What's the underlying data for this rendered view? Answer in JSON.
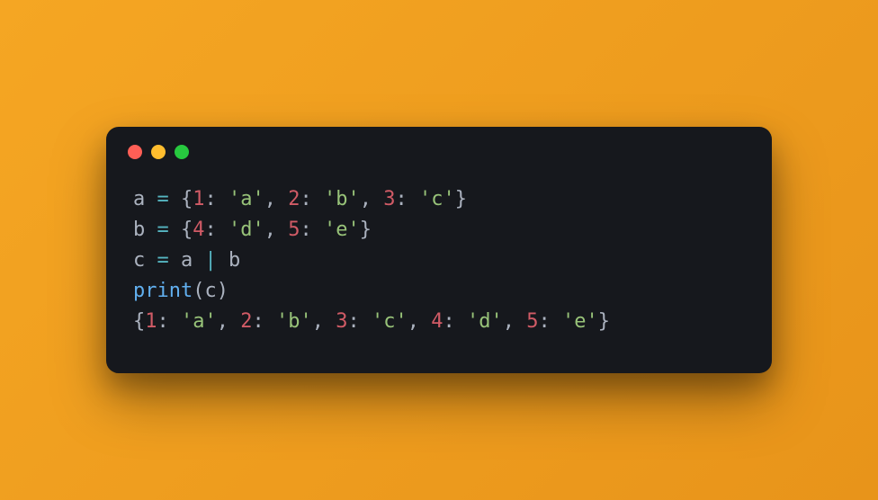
{
  "colors": {
    "close": "#ff5f56",
    "minimize": "#ffbd2e",
    "maximize": "#27c93f"
  },
  "code": {
    "lines": [
      [
        {
          "t": "a ",
          "c": "tok-var"
        },
        {
          "t": "=",
          "c": "tok-op"
        },
        {
          "t": " {",
          "c": "tok-punc"
        },
        {
          "t": "1",
          "c": "tok-num"
        },
        {
          "t": ": ",
          "c": "tok-punc"
        },
        {
          "t": "'a'",
          "c": "tok-str"
        },
        {
          "t": ", ",
          "c": "tok-punc"
        },
        {
          "t": "2",
          "c": "tok-num"
        },
        {
          "t": ": ",
          "c": "tok-punc"
        },
        {
          "t": "'b'",
          "c": "tok-str"
        },
        {
          "t": ", ",
          "c": "tok-punc"
        },
        {
          "t": "3",
          "c": "tok-num"
        },
        {
          "t": ": ",
          "c": "tok-punc"
        },
        {
          "t": "'c'",
          "c": "tok-str"
        },
        {
          "t": "}",
          "c": "tok-punc"
        }
      ],
      [
        {
          "t": "b ",
          "c": "tok-var"
        },
        {
          "t": "=",
          "c": "tok-op"
        },
        {
          "t": " {",
          "c": "tok-punc"
        },
        {
          "t": "4",
          "c": "tok-num"
        },
        {
          "t": ": ",
          "c": "tok-punc"
        },
        {
          "t": "'d'",
          "c": "tok-str"
        },
        {
          "t": ", ",
          "c": "tok-punc"
        },
        {
          "t": "5",
          "c": "tok-num"
        },
        {
          "t": ": ",
          "c": "tok-punc"
        },
        {
          "t": "'e'",
          "c": "tok-str"
        },
        {
          "t": "}",
          "c": "tok-punc"
        }
      ],
      [
        {
          "t": "c ",
          "c": "tok-var"
        },
        {
          "t": "=",
          "c": "tok-op"
        },
        {
          "t": " a ",
          "c": "tok-var"
        },
        {
          "t": "|",
          "c": "tok-op"
        },
        {
          "t": " b",
          "c": "tok-var"
        }
      ],
      [
        {
          "t": "print",
          "c": "tok-func"
        },
        {
          "t": "(c)",
          "c": "tok-punc"
        }
      ],
      [
        {
          "t": "{",
          "c": "tok-punc"
        },
        {
          "t": "1",
          "c": "tok-num"
        },
        {
          "t": ": ",
          "c": "tok-punc"
        },
        {
          "t": "'a'",
          "c": "tok-str"
        },
        {
          "t": ", ",
          "c": "tok-punc"
        },
        {
          "t": "2",
          "c": "tok-num"
        },
        {
          "t": ": ",
          "c": "tok-punc"
        },
        {
          "t": "'b'",
          "c": "tok-str"
        },
        {
          "t": ", ",
          "c": "tok-punc"
        },
        {
          "t": "3",
          "c": "tok-num"
        },
        {
          "t": ": ",
          "c": "tok-punc"
        },
        {
          "t": "'c'",
          "c": "tok-str"
        },
        {
          "t": ", ",
          "c": "tok-punc"
        },
        {
          "t": "4",
          "c": "tok-num"
        },
        {
          "t": ": ",
          "c": "tok-punc"
        },
        {
          "t": "'d'",
          "c": "tok-str"
        },
        {
          "t": ", ",
          "c": "tok-punc"
        },
        {
          "t": "5",
          "c": "tok-num"
        },
        {
          "t": ": ",
          "c": "tok-punc"
        },
        {
          "t": "'e'",
          "c": "tok-str"
        },
        {
          "t": "}",
          "c": "tok-punc"
        }
      ]
    ]
  }
}
